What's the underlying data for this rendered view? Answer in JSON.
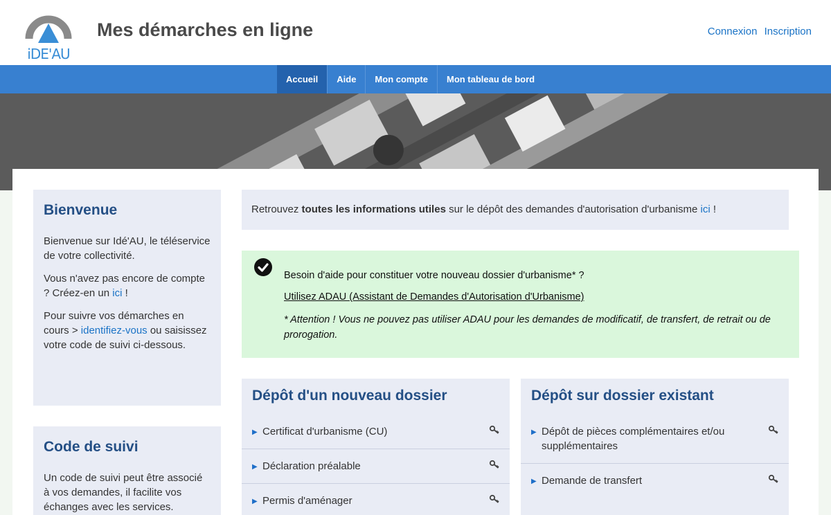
{
  "header": {
    "logo_text": "iDE'AU",
    "title": "Mes démarches en ligne",
    "login": "Connexion",
    "register": "Inscription"
  },
  "nav": [
    "Accueil",
    "Aide",
    "Mon compte",
    "Mon tableau de bord"
  ],
  "sidebar": {
    "welcome_title": "Bienvenue",
    "welcome_p1": "Bienvenue sur Idé'AU, le téléservice de votre collectivité.",
    "welcome_p2_before": "Vous n'avez pas encore de compte ? Créez-en un ",
    "welcome_p2_link": "ici",
    "welcome_p2_after": " !",
    "welcome_p3_before": "Pour suivre vos démarches en cours > ",
    "welcome_p3_link": "identifiez-vous",
    "welcome_p3_after": " ou saisissez votre code de suivi ci-dessous.",
    "code_title": "Code de suivi",
    "code_p1": "Un code de suivi peut être associé à vos demandes, il facilite vos échanges avec les services."
  },
  "info": {
    "before": "Retrouvez ",
    "bold": "toutes les informations utiles",
    "after": " sur le dépôt des demandes d'autorisation d'urbanisme ",
    "link": "ici",
    "end": " !"
  },
  "help": {
    "question": "Besoin d'aide pour constituer votre nouveau dossier d'urbanisme* ?",
    "link": "Utilisez ADAU (Assistant de Demandes d'Autorisation d'Urbanisme)",
    "note": "* Attention ! Vous ne pouvez pas utiliser ADAU pour les demandes de modificatif, de transfert, de retrait ou de prorogation."
  },
  "new_file": {
    "title": "Dépôt d'un nouveau dossier",
    "items": [
      "Certificat d'urbanisme (CU)",
      "Déclaration préalable",
      "Permis d'aménager"
    ]
  },
  "existing_file": {
    "title": "Dépôt sur dossier existant",
    "items": [
      "Dépôt de pièces complémentaires et/ou supplémentaires",
      "Demande de transfert"
    ]
  }
}
